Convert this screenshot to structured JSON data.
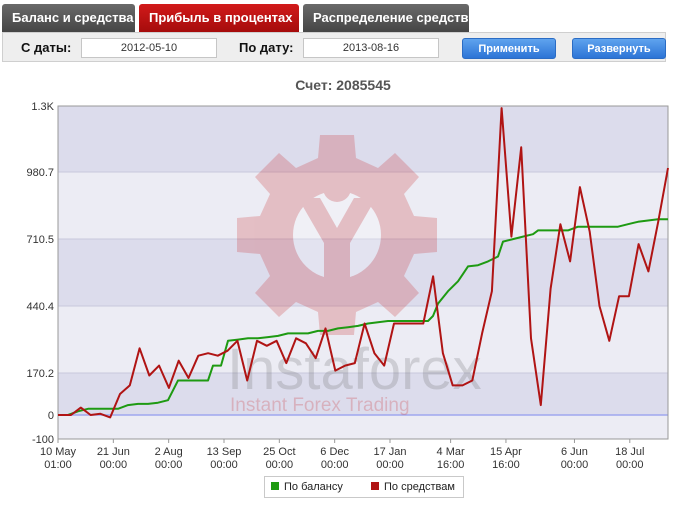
{
  "tabs": [
    {
      "label": "Баланс и средства",
      "active": false
    },
    {
      "label": "Прибыль в процентах",
      "active": true
    },
    {
      "label": "Распределение средств",
      "active": false
    }
  ],
  "filters": {
    "from_label": "С даты:",
    "from_value": "2012-05-10",
    "to_label": "По дату:",
    "to_value": "2013-08-16",
    "apply_label": "Применить",
    "expand_label": "Развернуть"
  },
  "watermark": {
    "brand": "Instaforex",
    "tagline": "Instant Forex Trading"
  },
  "colors": {
    "accent_red": "#b11010",
    "tab_dark": "#555555",
    "button_blue": "#3a86e0",
    "balance_series": "#1e9a12",
    "equity_series": "#b01414"
  },
  "chart_data": {
    "type": "line",
    "title": "Счет: 2085545",
    "y_ticks": [
      -100,
      0,
      170.2,
      440.4,
      710.5,
      980.7,
      1300
    ],
    "y_tick_labels": [
      "-100",
      "0",
      "170.2",
      "440.4",
      "710.5",
      "980.7",
      "1.3K"
    ],
    "ylim": [
      -100,
      1300
    ],
    "x_ticks": [
      {
        "day": 0,
        "date": "10 May",
        "time": "01:00"
      },
      {
        "day": 42,
        "date": "21 Jun",
        "time": "00:00"
      },
      {
        "day": 84,
        "date": "2 Aug",
        "time": "00:00"
      },
      {
        "day": 126,
        "date": "13 Sep",
        "time": "00:00"
      },
      {
        "day": 168,
        "date": "25 Oct",
        "time": "00:00"
      },
      {
        "day": 210,
        "date": "6 Dec",
        "time": "00:00"
      },
      {
        "day": 252,
        "date": "17 Jan",
        "time": "00:00"
      },
      {
        "day": 298,
        "date": "4 Mar",
        "time": "16:00"
      },
      {
        "day": 340,
        "date": "15 Apr",
        "time": "16:00"
      },
      {
        "day": 392,
        "date": "6 Jun",
        "time": "00:00"
      },
      {
        "day": 434,
        "date": "18 Jul",
        "time": "00:00"
      }
    ],
    "xlim": [
      0,
      463
    ],
    "grid": true,
    "legend_position": "bottom",
    "series": [
      {
        "name": "По балансу",
        "color": "#1e9a12",
        "points": [
          [
            0,
            0
          ],
          [
            10,
            0
          ],
          [
            20,
            15
          ],
          [
            30,
            25
          ],
          [
            40,
            25
          ],
          [
            50,
            25
          ],
          [
            60,
            25
          ],
          [
            70,
            40
          ],
          [
            80,
            45
          ],
          [
            90,
            45
          ],
          [
            100,
            50
          ],
          [
            110,
            60
          ],
          [
            120,
            140
          ],
          [
            130,
            140
          ],
          [
            140,
            140
          ],
          [
            150,
            140
          ],
          [
            155,
            200
          ],
          [
            163,
            200
          ],
          [
            170,
            300
          ],
          [
            180,
            305
          ],
          [
            190,
            310
          ],
          [
            200,
            310
          ],
          [
            210,
            315
          ],
          [
            220,
            320
          ],
          [
            230,
            330
          ],
          [
            240,
            330
          ],
          [
            250,
            330
          ],
          [
            260,
            340
          ],
          [
            270,
            340
          ],
          [
            280,
            350
          ],
          [
            290,
            355
          ],
          [
            300,
            360
          ],
          [
            310,
            370
          ],
          [
            320,
            375
          ],
          [
            330,
            380
          ],
          [
            340,
            380
          ],
          [
            350,
            380
          ],
          [
            360,
            380
          ],
          [
            370,
            380
          ],
          [
            375,
            400
          ],
          [
            380,
            450
          ],
          [
            390,
            500
          ],
          [
            400,
            540
          ],
          [
            405,
            570
          ],
          [
            410,
            600
          ],
          [
            420,
            605
          ],
          [
            430,
            620
          ],
          [
            440,
            640
          ],
          [
            445,
            700
          ],
          [
            455,
            710
          ],
          [
            465,
            720
          ],
          [
            475,
            730
          ],
          [
            480,
            745
          ],
          [
            490,
            745
          ],
          [
            500,
            745
          ],
          [
            510,
            745
          ],
          [
            520,
            760
          ],
          [
            530,
            760
          ],
          [
            540,
            760
          ],
          [
            550,
            760
          ],
          [
            560,
            760
          ],
          [
            570,
            770
          ],
          [
            580,
            780
          ],
          [
            590,
            785
          ],
          [
            600,
            790
          ],
          [
            610,
            790
          ]
        ]
      },
      {
        "name": "По средствам",
        "color": "#b01414",
        "points": [
          [
            0,
            0
          ],
          [
            8,
            0
          ],
          [
            14,
            30
          ],
          [
            20,
            0
          ],
          [
            26,
            5
          ],
          [
            32,
            -10
          ],
          [
            38,
            85
          ],
          [
            44,
            120
          ],
          [
            50,
            270
          ],
          [
            56,
            160
          ],
          [
            62,
            200
          ],
          [
            68,
            110
          ],
          [
            74,
            220
          ],
          [
            80,
            150
          ],
          [
            86,
            240
          ],
          [
            92,
            250
          ],
          [
            98,
            240
          ],
          [
            104,
            260
          ],
          [
            110,
            300
          ],
          [
            116,
            140
          ],
          [
            122,
            300
          ],
          [
            128,
            280
          ],
          [
            134,
            300
          ],
          [
            140,
            210
          ],
          [
            146,
            310
          ],
          [
            152,
            290
          ],
          [
            158,
            230
          ],
          [
            164,
            350
          ],
          [
            170,
            180
          ],
          [
            176,
            200
          ],
          [
            182,
            210
          ],
          [
            188,
            370
          ],
          [
            194,
            250
          ],
          [
            200,
            200
          ],
          [
            206,
            370
          ],
          [
            212,
            370
          ],
          [
            218,
            370
          ],
          [
            224,
            370
          ],
          [
            230,
            560
          ],
          [
            236,
            250
          ],
          [
            242,
            120
          ],
          [
            248,
            120
          ],
          [
            254,
            140
          ],
          [
            260,
            330
          ],
          [
            266,
            500
          ],
          [
            272,
            1290
          ],
          [
            278,
            720
          ],
          [
            284,
            1100
          ],
          [
            290,
            310
          ],
          [
            296,
            40
          ],
          [
            302,
            510
          ],
          [
            308,
            770
          ],
          [
            314,
            620
          ],
          [
            320,
            920
          ],
          [
            326,
            740
          ],
          [
            332,
            440
          ],
          [
            338,
            300
          ],
          [
            344,
            480
          ],
          [
            350,
            480
          ],
          [
            356,
            690
          ],
          [
            362,
            580
          ],
          [
            368,
            780
          ],
          [
            374,
            1000
          ]
        ]
      }
    ]
  }
}
